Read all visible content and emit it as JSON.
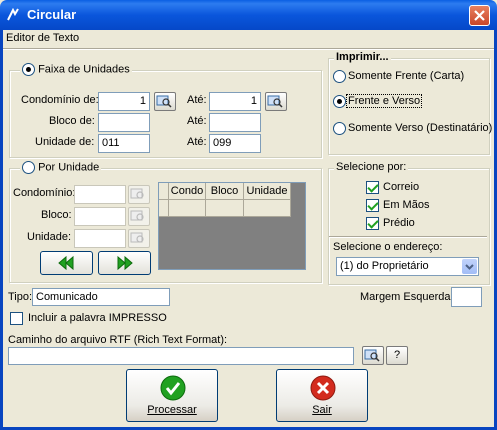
{
  "window": {
    "title": "Circular",
    "close_label": "✕"
  },
  "menu": {
    "items": [
      {
        "label": "Editor de Texto"
      }
    ]
  },
  "faixa": {
    "label": "Faixa de Unidades",
    "condominio_label": "Condomínio de:",
    "condominio_de": "1",
    "ate_label": "Até:",
    "condominio_ate": "1",
    "bloco_label": "Bloco de:",
    "bloco_de": "",
    "bloco_ate": "",
    "unidade_label": "Unidade de:",
    "unidade_de": "011",
    "unidade_ate": "099"
  },
  "por_unidade": {
    "label": "Por Unidade",
    "condominio_label": "Condomínio:",
    "bloco_label": "Bloco:",
    "unidade_label": "Unidade:",
    "columns": [
      "Condo",
      "Bloco",
      "Unidade"
    ]
  },
  "imprimir": {
    "label": "Imprimir...",
    "options": [
      "Somente Frente (Carta)",
      "Frente e Verso",
      "Somente Verso (Destinatário)"
    ],
    "selected": "Frente e Verso"
  },
  "selecione_por": {
    "label": "Selecione por:",
    "options": [
      {
        "label": "Correio",
        "checked": true
      },
      {
        "label": "Em Mãos",
        "checked": true
      },
      {
        "label": "Prédio",
        "checked": true
      }
    ]
  },
  "endereco": {
    "label": "Selecione o endereço:",
    "value": "(1) do Proprietário"
  },
  "tipo": {
    "label": "Tipo:",
    "value": "Comunicado"
  },
  "margem": {
    "label": "Margem Esquerda:",
    "value": ""
  },
  "impresso": {
    "label": "Incluir a palavra IMPRESSO",
    "checked": false
  },
  "rtf": {
    "label": "Caminho do arquivo RTF (Rich Text Format):",
    "value": "",
    "help": "?"
  },
  "buttons": {
    "processar": "Processar",
    "sair": "Sair"
  },
  "colors": {
    "title_bar": "#0a56dc",
    "ok_green": "#21a121",
    "cancel_red": "#d32b1e"
  }
}
